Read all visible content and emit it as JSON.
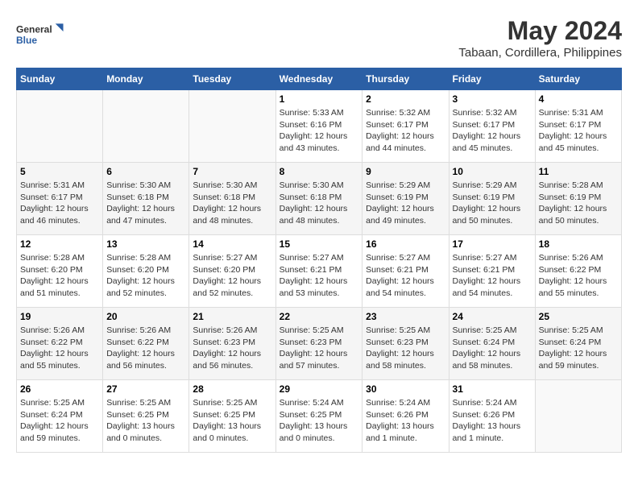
{
  "header": {
    "logo_general": "General",
    "logo_blue": "Blue",
    "title": "May 2024",
    "subtitle": "Tabaan, Cordillera, Philippines"
  },
  "weekdays": [
    "Sunday",
    "Monday",
    "Tuesday",
    "Wednesday",
    "Thursday",
    "Friday",
    "Saturday"
  ],
  "weeks": [
    [
      {
        "day": "",
        "info": ""
      },
      {
        "day": "",
        "info": ""
      },
      {
        "day": "",
        "info": ""
      },
      {
        "day": "1",
        "info": "Sunrise: 5:33 AM\nSunset: 6:16 PM\nDaylight: 12 hours\nand 43 minutes."
      },
      {
        "day": "2",
        "info": "Sunrise: 5:32 AM\nSunset: 6:17 PM\nDaylight: 12 hours\nand 44 minutes."
      },
      {
        "day": "3",
        "info": "Sunrise: 5:32 AM\nSunset: 6:17 PM\nDaylight: 12 hours\nand 45 minutes."
      },
      {
        "day": "4",
        "info": "Sunrise: 5:31 AM\nSunset: 6:17 PM\nDaylight: 12 hours\nand 45 minutes."
      }
    ],
    [
      {
        "day": "5",
        "info": "Sunrise: 5:31 AM\nSunset: 6:17 PM\nDaylight: 12 hours\nand 46 minutes."
      },
      {
        "day": "6",
        "info": "Sunrise: 5:30 AM\nSunset: 6:18 PM\nDaylight: 12 hours\nand 47 minutes."
      },
      {
        "day": "7",
        "info": "Sunrise: 5:30 AM\nSunset: 6:18 PM\nDaylight: 12 hours\nand 48 minutes."
      },
      {
        "day": "8",
        "info": "Sunrise: 5:30 AM\nSunset: 6:18 PM\nDaylight: 12 hours\nand 48 minutes."
      },
      {
        "day": "9",
        "info": "Sunrise: 5:29 AM\nSunset: 6:19 PM\nDaylight: 12 hours\nand 49 minutes."
      },
      {
        "day": "10",
        "info": "Sunrise: 5:29 AM\nSunset: 6:19 PM\nDaylight: 12 hours\nand 50 minutes."
      },
      {
        "day": "11",
        "info": "Sunrise: 5:28 AM\nSunset: 6:19 PM\nDaylight: 12 hours\nand 50 minutes."
      }
    ],
    [
      {
        "day": "12",
        "info": "Sunrise: 5:28 AM\nSunset: 6:20 PM\nDaylight: 12 hours\nand 51 minutes."
      },
      {
        "day": "13",
        "info": "Sunrise: 5:28 AM\nSunset: 6:20 PM\nDaylight: 12 hours\nand 52 minutes."
      },
      {
        "day": "14",
        "info": "Sunrise: 5:27 AM\nSunset: 6:20 PM\nDaylight: 12 hours\nand 52 minutes."
      },
      {
        "day": "15",
        "info": "Sunrise: 5:27 AM\nSunset: 6:21 PM\nDaylight: 12 hours\nand 53 minutes."
      },
      {
        "day": "16",
        "info": "Sunrise: 5:27 AM\nSunset: 6:21 PM\nDaylight: 12 hours\nand 54 minutes."
      },
      {
        "day": "17",
        "info": "Sunrise: 5:27 AM\nSunset: 6:21 PM\nDaylight: 12 hours\nand 54 minutes."
      },
      {
        "day": "18",
        "info": "Sunrise: 5:26 AM\nSunset: 6:22 PM\nDaylight: 12 hours\nand 55 minutes."
      }
    ],
    [
      {
        "day": "19",
        "info": "Sunrise: 5:26 AM\nSunset: 6:22 PM\nDaylight: 12 hours\nand 55 minutes."
      },
      {
        "day": "20",
        "info": "Sunrise: 5:26 AM\nSunset: 6:22 PM\nDaylight: 12 hours\nand 56 minutes."
      },
      {
        "day": "21",
        "info": "Sunrise: 5:26 AM\nSunset: 6:23 PM\nDaylight: 12 hours\nand 56 minutes."
      },
      {
        "day": "22",
        "info": "Sunrise: 5:25 AM\nSunset: 6:23 PM\nDaylight: 12 hours\nand 57 minutes."
      },
      {
        "day": "23",
        "info": "Sunrise: 5:25 AM\nSunset: 6:23 PM\nDaylight: 12 hours\nand 58 minutes."
      },
      {
        "day": "24",
        "info": "Sunrise: 5:25 AM\nSunset: 6:24 PM\nDaylight: 12 hours\nand 58 minutes."
      },
      {
        "day": "25",
        "info": "Sunrise: 5:25 AM\nSunset: 6:24 PM\nDaylight: 12 hours\nand 59 minutes."
      }
    ],
    [
      {
        "day": "26",
        "info": "Sunrise: 5:25 AM\nSunset: 6:24 PM\nDaylight: 12 hours\nand 59 minutes."
      },
      {
        "day": "27",
        "info": "Sunrise: 5:25 AM\nSunset: 6:25 PM\nDaylight: 13 hours\nand 0 minutes."
      },
      {
        "day": "28",
        "info": "Sunrise: 5:25 AM\nSunset: 6:25 PM\nDaylight: 13 hours\nand 0 minutes."
      },
      {
        "day": "29",
        "info": "Sunrise: 5:24 AM\nSunset: 6:25 PM\nDaylight: 13 hours\nand 0 minutes."
      },
      {
        "day": "30",
        "info": "Sunrise: 5:24 AM\nSunset: 6:26 PM\nDaylight: 13 hours\nand 1 minute."
      },
      {
        "day": "31",
        "info": "Sunrise: 5:24 AM\nSunset: 6:26 PM\nDaylight: 13 hours\nand 1 minute."
      },
      {
        "day": "",
        "info": ""
      }
    ]
  ]
}
